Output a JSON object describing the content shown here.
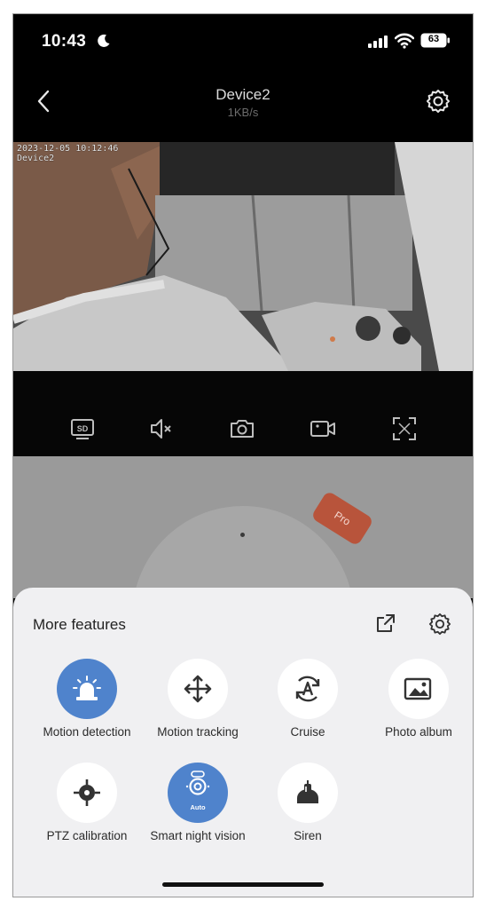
{
  "status_bar": {
    "time": "10:43",
    "battery": "63"
  },
  "header": {
    "title": "Device2",
    "rate": "1KB/s"
  },
  "video": {
    "osd_line1": "2023-12-05 10:12:46",
    "osd_line2": "Device2"
  },
  "controls": {
    "icons": [
      "sd-quality-icon",
      "mute-icon",
      "snapshot-icon",
      "record-icon",
      "fullscreen-icon"
    ],
    "sd_label": "SD"
  },
  "ptz": {
    "pro_label": "Pro"
  },
  "sheet": {
    "title": "More features",
    "features": [
      {
        "label": "Motion detection",
        "icon": "alarm-light-icon",
        "active": true
      },
      {
        "label": "Motion tracking",
        "icon": "move-arrows-icon",
        "active": false
      },
      {
        "label": "Cruise",
        "icon": "cruise-icon",
        "active": false
      },
      {
        "label": "Photo album",
        "icon": "photo-album-icon",
        "active": false
      },
      {
        "label": "PTZ calibration",
        "icon": "crosshair-icon",
        "active": false
      },
      {
        "label": "Smart night vision",
        "icon": "night-vision-icon",
        "active": true,
        "badge": "Auto"
      },
      {
        "label": "Siren",
        "icon": "siren-icon",
        "active": false
      }
    ]
  },
  "colors": {
    "accent": "#4f83cc",
    "pro": "#b8543b",
    "sheet_bg": "#f0f0f2"
  }
}
